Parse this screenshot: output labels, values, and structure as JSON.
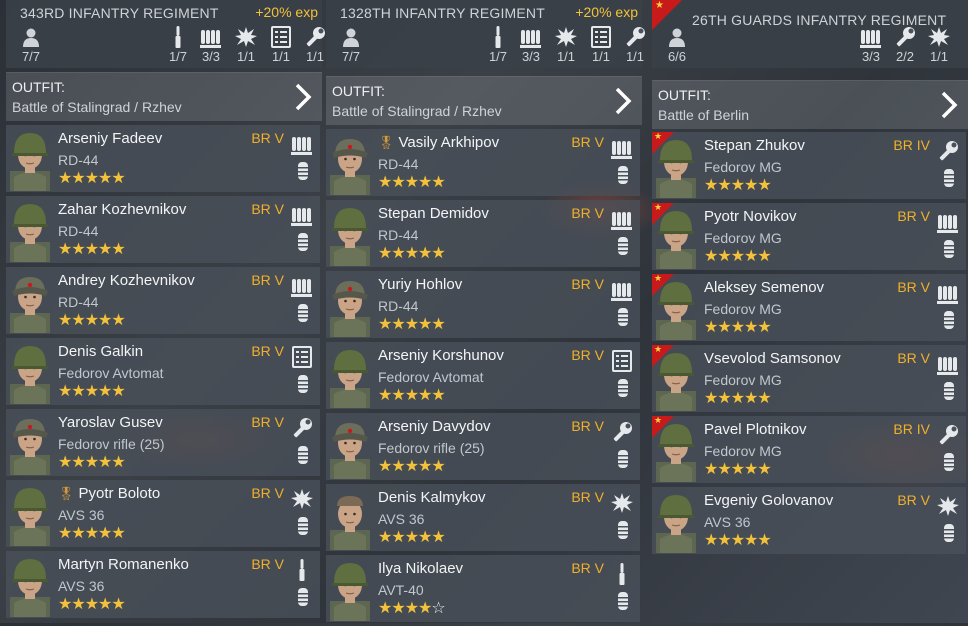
{
  "columns": [
    {
      "title": "343RD INFANTRY REGIMENT",
      "bonus": "+20% exp",
      "has_flag": false,
      "stats": [
        {
          "icon": "soldier-icon",
          "value": "7/7"
        },
        {
          "icon": "rifle-icon",
          "value": "1/7"
        },
        {
          "icon": "ammo-icon",
          "value": "3/3"
        },
        {
          "icon": "explosion-icon",
          "value": "1/1"
        },
        {
          "icon": "radio-icon",
          "value": "1/1"
        },
        {
          "icon": "wrench-icon",
          "value": "1/1"
        }
      ],
      "outfit_label": "OUTFIT:",
      "outfit_value": "Battle of Stalingrad / Rzhev",
      "soldiers": [
        {
          "name": "Arseniy Fadeev",
          "weapon": "RD-44",
          "br": "BR V",
          "stars": 5,
          "role": "ammo-icon",
          "helmet": "helmet",
          "medal": false,
          "flag": false
        },
        {
          "name": "Zahar Kozhevnikov",
          "weapon": "RD-44",
          "br": "BR V",
          "stars": 5,
          "role": "ammo-icon",
          "helmet": "helmet",
          "medal": false,
          "flag": false
        },
        {
          "name": "Andrey Kozhevnikov",
          "weapon": "RD-44",
          "br": "BR V",
          "stars": 5,
          "role": "ammo-icon",
          "helmet": "cap",
          "medal": false,
          "flag": false
        },
        {
          "name": "Denis Galkin",
          "weapon": "Fedorov Avtomat",
          "br": "BR V",
          "stars": 5,
          "role": "radio-icon",
          "helmet": "helmet",
          "medal": false,
          "flag": false
        },
        {
          "name": "Yaroslav Gusev",
          "weapon": "Fedorov rifle (25)",
          "br": "BR V",
          "stars": 5,
          "role": "wrench-icon",
          "helmet": "cap",
          "medal": false,
          "flag": false
        },
        {
          "name": "Pyotr Boloto",
          "weapon": "AVS 36",
          "br": "BR V",
          "stars": 5,
          "role": "explosion-icon",
          "helmet": "helmet",
          "medal": true,
          "flag": false
        },
        {
          "name": "Martyn Romanenko",
          "weapon": "AVS 36",
          "br": "BR V",
          "stars": 5,
          "role": "rifle-icon",
          "helmet": "helmet",
          "medal": false,
          "flag": false
        }
      ]
    },
    {
      "title": "1328TH INFANTRY REGIMENT",
      "bonus": "+20% exp",
      "has_flag": false,
      "stats": [
        {
          "icon": "soldier-icon",
          "value": "7/7"
        },
        {
          "icon": "rifle-icon",
          "value": "1/7"
        },
        {
          "icon": "ammo-icon",
          "value": "3/3"
        },
        {
          "icon": "explosion-icon",
          "value": "1/1"
        },
        {
          "icon": "radio-icon",
          "value": "1/1"
        },
        {
          "icon": "wrench-icon",
          "value": "1/1"
        }
      ],
      "outfit_label": "OUTFIT:",
      "outfit_value": "Battle of Stalingrad / Rzhev",
      "soldiers": [
        {
          "name": "Vasily Arkhipov",
          "weapon": "RD-44",
          "br": "BR V",
          "stars": 5,
          "role": "ammo-icon",
          "helmet": "cap",
          "medal": true,
          "flag": false
        },
        {
          "name": "Stepan Demidov",
          "weapon": "RD-44",
          "br": "BR V",
          "stars": 5,
          "role": "ammo-icon",
          "helmet": "helmet",
          "medal": false,
          "flag": false
        },
        {
          "name": "Yuriy Hohlov",
          "weapon": "RD-44",
          "br": "BR V",
          "stars": 5,
          "role": "ammo-icon",
          "helmet": "cap",
          "medal": false,
          "flag": false
        },
        {
          "name": "Arseniy Korshunov",
          "weapon": "Fedorov Avtomat",
          "br": "BR V",
          "stars": 5,
          "role": "radio-icon",
          "helmet": "helmet",
          "medal": false,
          "flag": false
        },
        {
          "name": "Arseniy Davydov",
          "weapon": "Fedorov rifle (25)",
          "br": "BR V",
          "stars": 5,
          "role": "wrench-icon",
          "helmet": "cap",
          "medal": false,
          "flag": false
        },
        {
          "name": "Denis Kalmykov",
          "weapon": "AVS 36",
          "br": "BR V",
          "stars": 5,
          "role": "explosion-icon",
          "helmet": "bare",
          "medal": false,
          "flag": false
        },
        {
          "name": "Ilya Nikolaev",
          "weapon": "AVT-40",
          "br": "BR V",
          "stars": 4,
          "role": "rifle-icon",
          "helmet": "helmet",
          "medal": false,
          "flag": false
        }
      ]
    },
    {
      "title": "26TH GUARDS INFANTRY REGIMENT",
      "bonus": "",
      "has_flag": true,
      "stats": [
        {
          "icon": "soldier-icon",
          "value": "6/6"
        },
        {
          "icon": "ammo-icon",
          "value": "3/3"
        },
        {
          "icon": "wrench-icon",
          "value": "2/2"
        },
        {
          "icon": "explosion-icon",
          "value": "1/1"
        }
      ],
      "outfit_label": "OUTFIT:",
      "outfit_value": "Battle of Berlin",
      "soldiers": [
        {
          "name": "Stepan Zhukov",
          "weapon": "Fedorov MG",
          "br": "BR IV",
          "stars": 5,
          "role": "wrench-icon",
          "helmet": "helmet",
          "medal": false,
          "flag": true
        },
        {
          "name": "Pyotr Novikov",
          "weapon": "Fedorov MG",
          "br": "BR V",
          "stars": 5,
          "role": "ammo-icon",
          "helmet": "helmet",
          "medal": false,
          "flag": true
        },
        {
          "name": "Aleksey Semenov",
          "weapon": "Fedorov MG",
          "br": "BR V",
          "stars": 5,
          "role": "ammo-icon",
          "helmet": "helmet",
          "medal": false,
          "flag": true
        },
        {
          "name": "Vsevolod Samsonov",
          "weapon": "Fedorov MG",
          "br": "BR V",
          "stars": 5,
          "role": "ammo-icon",
          "helmet": "helmet",
          "medal": false,
          "flag": true
        },
        {
          "name": "Pavel Plotnikov",
          "weapon": "Fedorov MG",
          "br": "BR IV",
          "stars": 5,
          "role": "wrench-icon",
          "helmet": "helmet",
          "medal": false,
          "flag": true
        },
        {
          "name": "Evgeniy Golovanov",
          "weapon": "AVS 36",
          "br": "BR V",
          "stars": 5,
          "role": "explosion-icon",
          "helmet": "helmet",
          "medal": false,
          "flag": false
        }
      ]
    }
  ]
}
